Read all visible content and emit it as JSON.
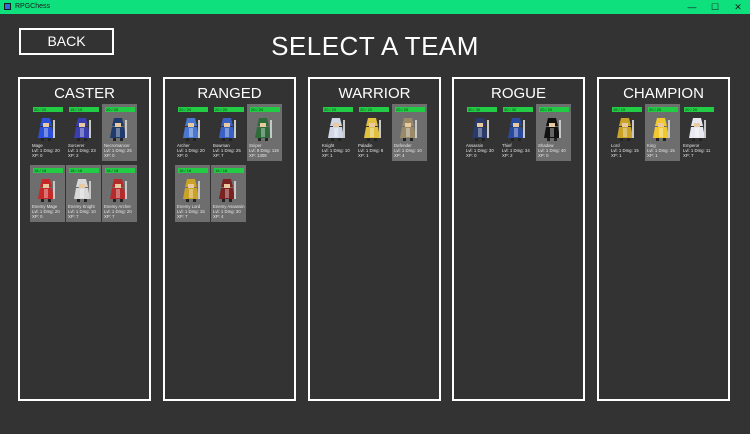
{
  "window": {
    "title": "RPGChess",
    "minimize": "—",
    "maximize": "☐",
    "close": "✕"
  },
  "header": {
    "back_label": "BACK",
    "title": "SELECT A TEAM"
  },
  "colors": {
    "background": "#333333",
    "titlebar": "#0fe07e",
    "hp_bar": "#22cc44",
    "selected_card": "#6e6e6e"
  },
  "panels": [
    {
      "title": "CASTER",
      "units": [
        {
          "hp": "20 / 20",
          "name": "Mage",
          "stats": "Lvl: 1 Dmg: 20",
          "xp": "XP: 0",
          "icon": "mage-sprite-icon",
          "selected": false,
          "color": "#2b4fd8"
        },
        {
          "hp": "15 / 15",
          "name": "Sorcerer",
          "stats": "Lvl: 1 Dmg: 23",
          "xp": "XP: 2",
          "icon": "sorcerer-sprite-icon",
          "selected": false,
          "color": "#3a3fb0"
        },
        {
          "hp": "20 / 20",
          "name": "Necromancer",
          "stats": "Lvl: 1 Dmg: 25",
          "xp": "XP: 0",
          "icon": "necromancer-sprite-icon",
          "selected": true,
          "color": "#1f3b6e"
        },
        {
          "hp": "18 / 18",
          "name": "Enemy Mage",
          "stats": "Lvl: 1 Dmg: 20",
          "xp": "XP: 0",
          "icon": "enemy-mage-sprite-icon",
          "selected": true,
          "color": "#c62828"
        },
        {
          "hp": "18 / 18",
          "name": "Enemy Knight",
          "stats": "Lvl: 1 Dmg: 10",
          "xp": "XP: 7",
          "icon": "enemy-knight-sprite-icon",
          "selected": true,
          "color": "#d8d8d8"
        },
        {
          "hp": "18 / 18",
          "name": "Enemy Archer",
          "stats": "Lvl: 1 Dmg: 20",
          "xp": "XP: 7",
          "icon": "enemy-archer-sprite-icon",
          "selected": true,
          "color": "#b52a2a"
        }
      ]
    },
    {
      "title": "RANGED",
      "units": [
        {
          "hp": "20 / 20",
          "name": "Archer",
          "stats": "Lvl: 1 Dmg: 20",
          "xp": "XP: 0",
          "icon": "archer-sprite-icon",
          "selected": false,
          "color": "#4a78d0"
        },
        {
          "hp": "20 / 20",
          "name": "Bowman",
          "stats": "Lvl: 1 Dmg: 25",
          "xp": "XP: 7",
          "icon": "bowman-sprite-icon",
          "selected": false,
          "color": "#3a62c4"
        },
        {
          "hp": "20 / 20",
          "name": "Sniper",
          "stats": "Lvl: 8 Dmg: 119",
          "xp": "XP: 1308",
          "icon": "sniper-sprite-icon",
          "selected": true,
          "color": "#2e6b3a"
        },
        {
          "hp": "18 / 18",
          "name": "Enemy Lord",
          "stats": "Lvl: 1 Dmg: 15",
          "xp": "XP: 7",
          "icon": "enemy-lord-sprite-icon",
          "selected": true,
          "color": "#c9a227"
        },
        {
          "hp": "18 / 18",
          "name": "Enemy Assassin",
          "stats": "Lvl: 1 Dmg: 30",
          "xp": "XP: 4",
          "icon": "enemy-assassin-sprite-icon",
          "selected": true,
          "color": "#7a2222"
        }
      ]
    },
    {
      "title": "WARRIOR",
      "units": [
        {
          "hp": "20 / 20",
          "name": "Knight",
          "stats": "Lvl: 1 Dmg: 10",
          "xp": "XP: 1",
          "icon": "knight-sprite-icon",
          "selected": false,
          "color": "#cfd6e6"
        },
        {
          "hp": "20 / 20",
          "name": "Paladin",
          "stats": "Lvl: 1 Dmg: 8",
          "xp": "XP: 1",
          "icon": "paladin-sprite-icon",
          "selected": false,
          "color": "#e0c040"
        },
        {
          "hp": "20 / 20",
          "name": "Defender",
          "stats": "Lvl: 1 Dmg: 10",
          "xp": "XP: 4",
          "icon": "defender-sprite-icon",
          "selected": true,
          "color": "#9a8a6a"
        }
      ]
    },
    {
      "title": "ROGUE",
      "units": [
        {
          "hp": "30 / 30",
          "name": "Assassin",
          "stats": "Lvl: 1 Dmg: 30",
          "xp": "XP: 0",
          "icon": "assassin-sprite-icon",
          "selected": false,
          "color": "#2a3a6a"
        },
        {
          "hp": "30 / 30",
          "name": "Thief",
          "stats": "Lvl: 1 Dmg: 34",
          "xp": "XP: 2",
          "icon": "thief-sprite-icon",
          "selected": false,
          "color": "#2a4aa0"
        },
        {
          "hp": "20 / 20",
          "name": "Shadow",
          "stats": "Lvl: 1 Dmg: 40",
          "xp": "XP: 0",
          "icon": "shadow-sprite-icon",
          "selected": true,
          "color": "#111111"
        }
      ]
    },
    {
      "title": "CHAMPION",
      "units": [
        {
          "hp": "15 / 15",
          "name": "Lord",
          "stats": "Lvl: 1 Dmg: 15",
          "xp": "XP: 1",
          "icon": "lord-sprite-icon",
          "selected": false,
          "color": "#c9a227"
        },
        {
          "hp": "20 / 20",
          "name": "King",
          "stats": "Lvl: 1 Dmg: 15",
          "xp": "XP: 1",
          "icon": "king-sprite-icon",
          "selected": true,
          "color": "#f0c830"
        },
        {
          "hp": "20 / 20",
          "name": "Emperor",
          "stats": "Lvl: 1 Dmg: 11",
          "xp": "XP: 7",
          "icon": "emperor-sprite-icon",
          "selected": false,
          "color": "#e8e8f0"
        }
      ]
    }
  ]
}
